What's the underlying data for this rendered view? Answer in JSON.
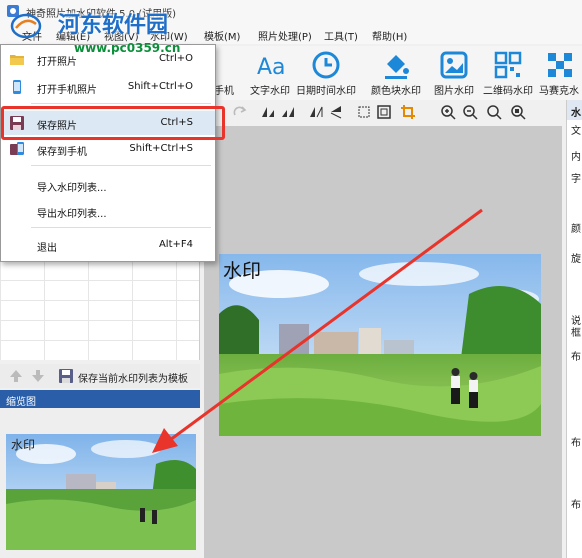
{
  "window": {
    "title": "神奇照片加水印软件 5.0 (试用版)",
    "app_icon": "app-icon"
  },
  "watermark": {
    "name": "河东软件园",
    "url": "www.pc0359.cn"
  },
  "menubar": {
    "items": [
      "文件",
      "编辑(E)",
      "视图(V)",
      "水印(W)",
      "模板(M)",
      "照片处理(P)",
      "工具(T)",
      "帮助(H)"
    ]
  },
  "toolbar": {
    "items": [
      {
        "label": "手机",
        "icon": "phone-icon"
      },
      {
        "label": "文字水印",
        "icon": "text-watermark-icon"
      },
      {
        "label": "日期时间水印",
        "icon": "clock-icon"
      },
      {
        "label": "颜色块水印",
        "icon": "paint-bucket-icon"
      },
      {
        "label": "图片水印",
        "icon": "image-watermark-icon"
      },
      {
        "label": "二维码水印",
        "icon": "qrcode-icon"
      },
      {
        "label": "马赛克水",
        "icon": "mosaic-icon"
      }
    ]
  },
  "file_menu": {
    "items": [
      {
        "label": "打开照片",
        "shortcut": "Ctrl+O",
        "icon": "open-folder-icon"
      },
      {
        "label": "打开手机照片",
        "shortcut": "Shift+Ctrl+O",
        "icon": "phone-icon"
      },
      {
        "label": "保存照片",
        "shortcut": "Ctrl+S",
        "icon": "save-icon"
      },
      {
        "label": "保存到手机",
        "shortcut": "Shift+Ctrl+S",
        "icon": "save-to-phone-icon"
      },
      {
        "label": "导入水印列表...",
        "shortcut": ""
      },
      {
        "label": "导出水印列表...",
        "shortcut": ""
      },
      {
        "label": "退出",
        "shortcut": "Alt+F4"
      }
    ],
    "highlighted": "保存照片",
    "highlight_color": "#e8342b"
  },
  "left_panel": {
    "save_template_label": "保存当前水印列表为模板",
    "thumbnail_header": "缩览图",
    "thumbnail_watermark": "水印"
  },
  "canvas": {
    "watermark_text": "水印"
  },
  "right_panel": {
    "header": "水",
    "labels": [
      "文",
      "内",
      "字",
      "颜",
      "旋",
      "说",
      "框",
      "布",
      "布",
      "布"
    ]
  },
  "colors": {
    "accent_blue": "#2a5ea8",
    "annotation_red": "#e8342b"
  }
}
